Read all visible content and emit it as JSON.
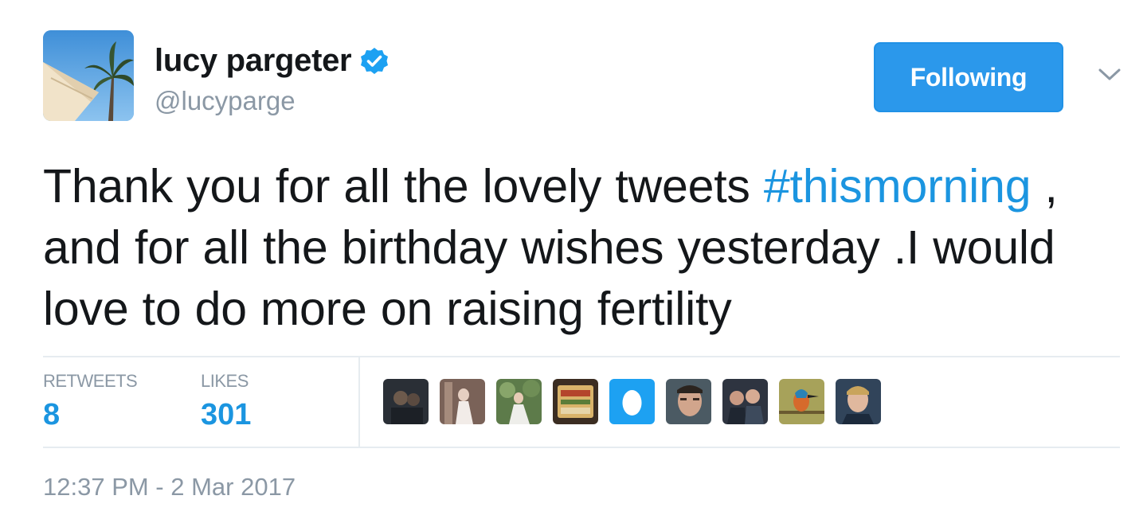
{
  "user": {
    "display_name": "lucy pargeter",
    "handle": "@lucyparge",
    "verified": true,
    "avatar_icon": "avatar-palm-umbrella"
  },
  "follow_button": {
    "label": "Following",
    "color": "#2b98eb"
  },
  "menu": {
    "icon": "chevron-down-icon"
  },
  "tweet": {
    "text_part1": "Thank you for all the lovely tweets ",
    "hashtag": "#thismorning",
    "text_part2": " , and for all the birthday wishes yesterday .I would love to do more on raising fertility"
  },
  "stats": {
    "retweets_label": "RETWEETS",
    "retweets_value": "8",
    "likes_label": "LIKES",
    "likes_value": "301"
  },
  "likers": [
    {
      "icon": "liker-avatar-1"
    },
    {
      "icon": "liker-avatar-2"
    },
    {
      "icon": "liker-avatar-3"
    },
    {
      "icon": "liker-avatar-4"
    },
    {
      "icon": "default-egg-avatar"
    },
    {
      "icon": "liker-avatar-6"
    },
    {
      "icon": "liker-avatar-7"
    },
    {
      "icon": "liker-avatar-kingfisher"
    },
    {
      "icon": "liker-avatar-9"
    }
  ],
  "timestamp": "12:37 PM - 2 Mar 2017",
  "colors": {
    "link_blue": "#1b95e0",
    "muted_gray": "#8b98a5",
    "divider": "#e6ecf0"
  }
}
